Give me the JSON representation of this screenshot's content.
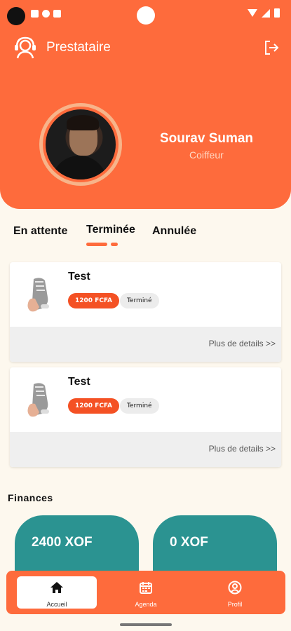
{
  "colors": {
    "accent": "#fe6b3c",
    "price_badge": "#f45124",
    "finance_card": "#2b9391",
    "background": "#fdf8ee"
  },
  "header": {
    "app_title": "Prestataire",
    "app_icon": "support-agent-icon",
    "logout_icon": "logout-icon"
  },
  "profile": {
    "name": "Sourav Suman",
    "role": "Coiffeur"
  },
  "tabs": [
    {
      "label": "En attente",
      "active": false
    },
    {
      "label": "Terminée",
      "active": true
    },
    {
      "label": "Annulée",
      "active": false
    }
  ],
  "orders": [
    {
      "title": "Test",
      "price": "1200 FCFA",
      "status": "Terminé",
      "details": "Plus de details >>"
    },
    {
      "title": "Test",
      "price": "1200 FCFA",
      "status": "Terminé",
      "details": "Plus de details >>"
    }
  ],
  "finances": {
    "title": "Finances",
    "cards": [
      {
        "value": "2400 XOF"
      },
      {
        "value": "0 XOF"
      }
    ]
  },
  "nav": [
    {
      "label": "Accueil",
      "icon": "home-icon",
      "active": true
    },
    {
      "label": "Agenda",
      "icon": "calendar-icon",
      "active": false
    },
    {
      "label": "Profil",
      "icon": "profile-icon",
      "active": false
    }
  ]
}
